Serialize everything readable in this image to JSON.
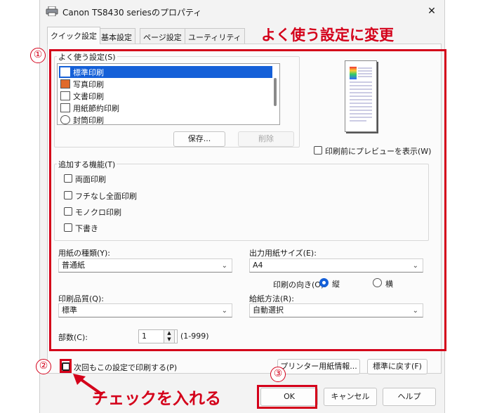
{
  "window": {
    "title": "Canon TS8430 seriesのプロパティ",
    "close": "✕"
  },
  "tabs": [
    {
      "label": "クイック設定",
      "active": true
    },
    {
      "label": "基本設定"
    },
    {
      "label": "ページ設定"
    },
    {
      "label": "ユーティリティ"
    }
  ],
  "favorites": {
    "label": "よく使う設定(S)",
    "items": [
      {
        "label": "標準印刷",
        "selected": true,
        "icon": "standard-print-icon"
      },
      {
        "label": "写真印刷",
        "icon": "photo-print-icon"
      },
      {
        "label": "文書印刷",
        "icon": "document-print-icon"
      },
      {
        "label": "用紙節約印刷",
        "icon": "paper-saving-icon"
      },
      {
        "label": "封筒印刷",
        "icon": "envelope-icon"
      }
    ],
    "save_button": "保存...",
    "delete_button": "削除"
  },
  "preview_checkbox": "印刷前にプレビューを表示(W)",
  "features": {
    "label": "追加する機能(T)",
    "items": [
      "両面印刷",
      "フチなし全面印刷",
      "モノクロ印刷",
      "下書き"
    ]
  },
  "media_type": {
    "label": "用紙の種類(Y):",
    "value": "普通紙"
  },
  "output_size": {
    "label": "出力用紙サイズ(E):",
    "value": "A4"
  },
  "orientation": {
    "label": "印刷の向き(O):",
    "portrait": "縦",
    "landscape": "横"
  },
  "quality": {
    "label": "印刷品質(Q):",
    "value": "標準"
  },
  "paper_source": {
    "label": "給紙方法(R):",
    "value": "自動選択"
  },
  "copies": {
    "label": "部数(C):",
    "value": "1",
    "range": "(1-999)"
  },
  "always_print_checkbox": "次回もこの設定で印刷する(P)",
  "printer_paper_info_button": "プリンター用紙情報...",
  "defaults_button": "標準に戻す(F)",
  "ok_button": "OK",
  "cancel_button": "キャンセル",
  "help_button": "ヘルプ",
  "annotations": {
    "top_caption": "よく使う設定に変更",
    "check_caption": "チェックを入れる",
    "marker1": "①",
    "marker2": "②",
    "marker3": "③"
  },
  "colors": {
    "annotation_red": "#d4001a",
    "selection_blue": "#1560d8"
  }
}
